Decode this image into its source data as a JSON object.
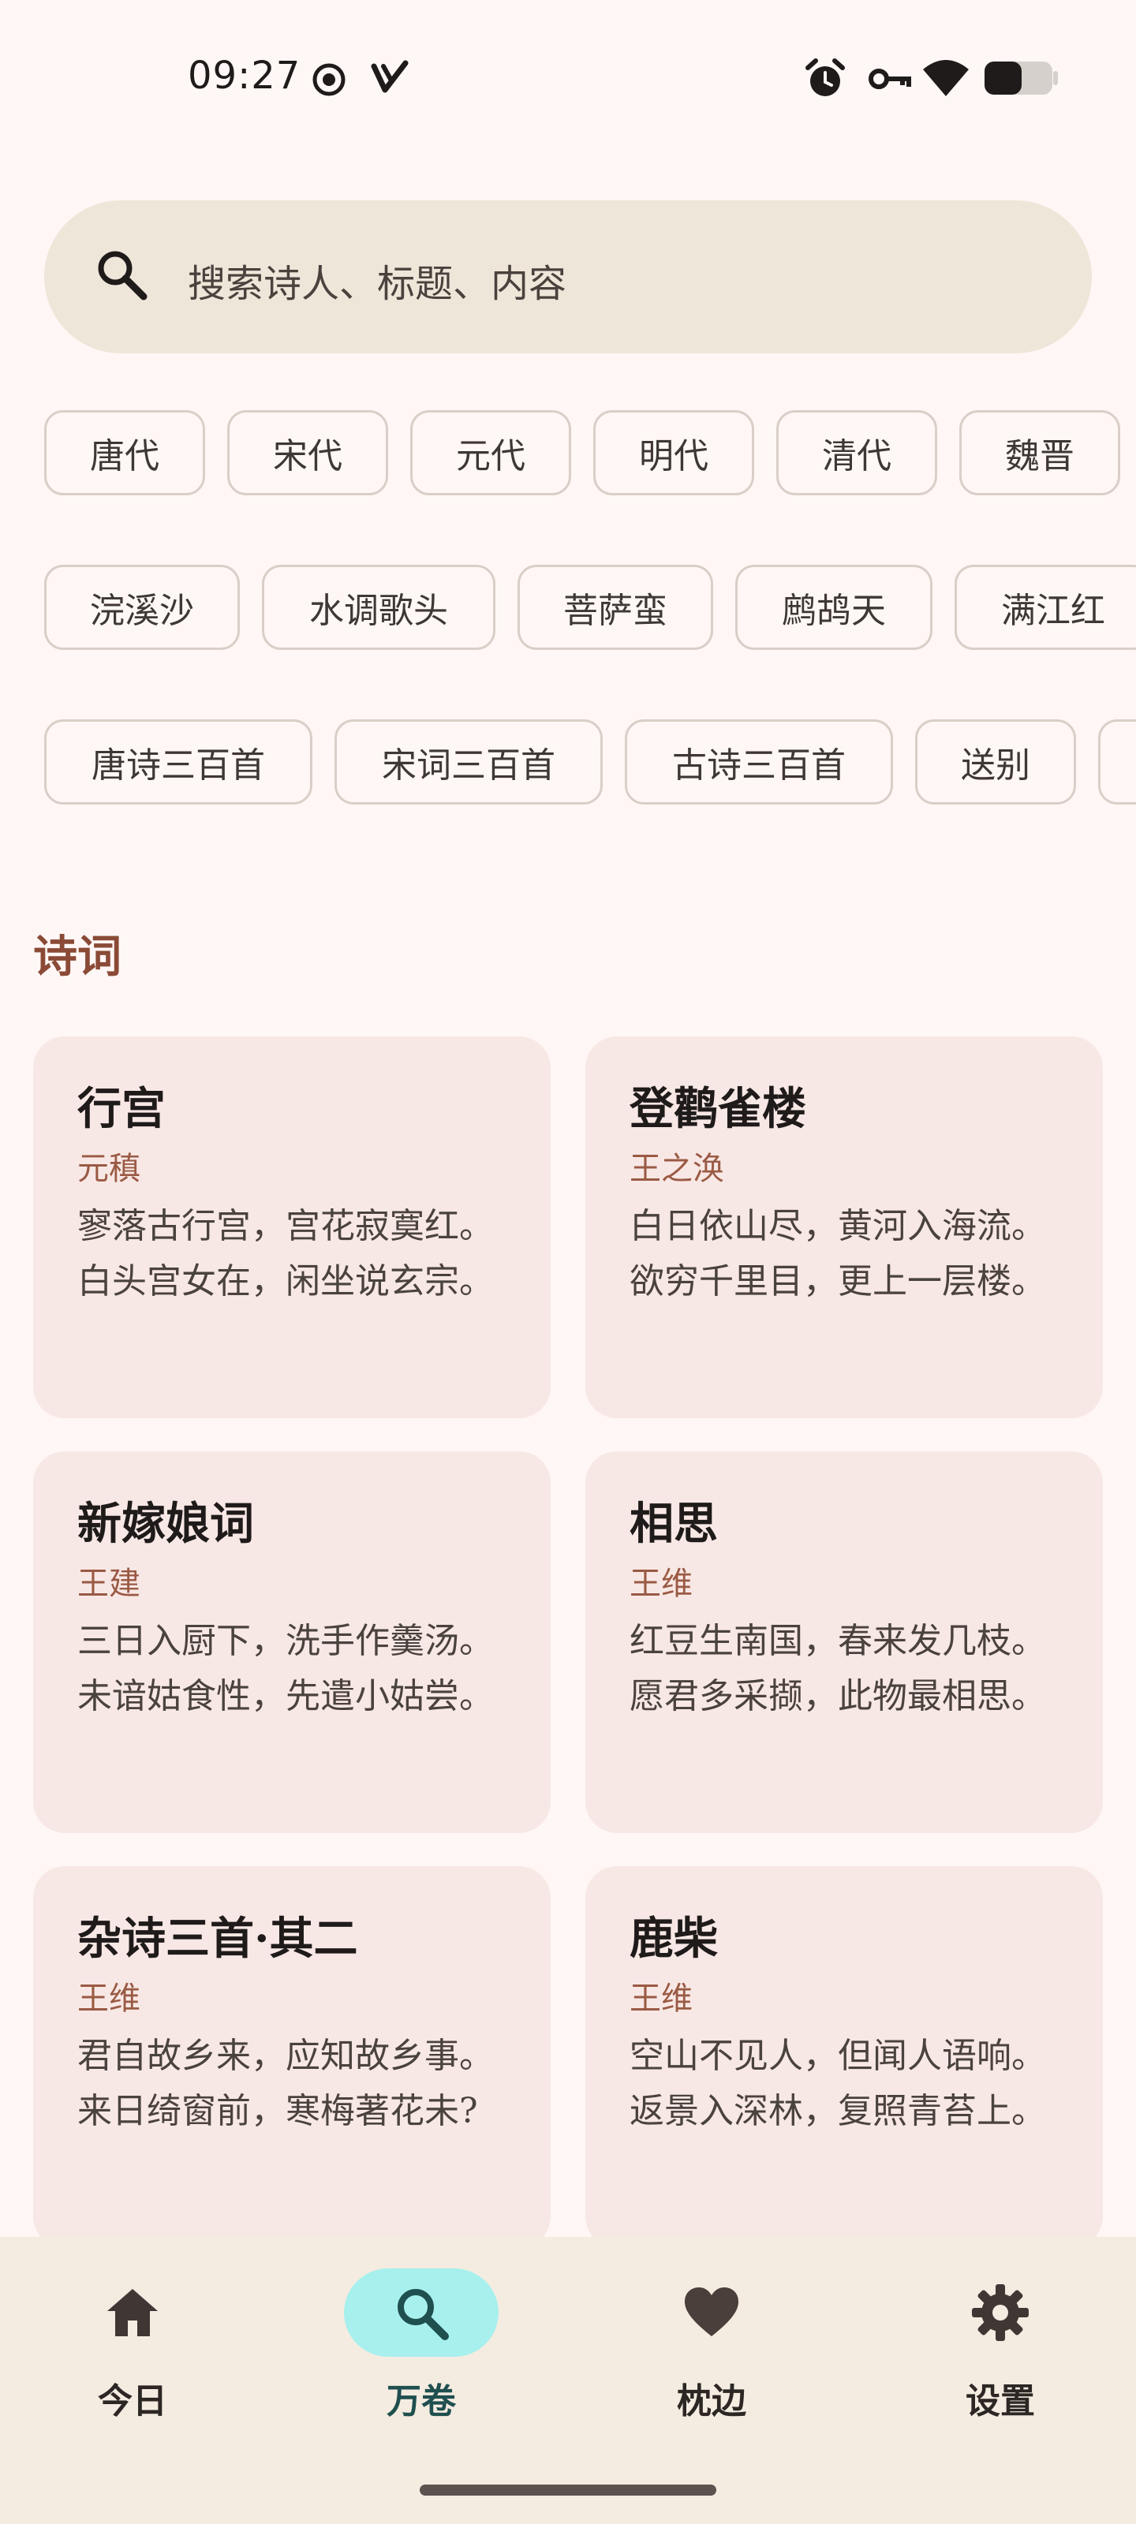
{
  "status_bar": {
    "time": "09:27",
    "icons": [
      "record-icon",
      "v-logo-icon",
      "alarm-icon",
      "key-icon",
      "wifi-icon",
      "battery-icon"
    ],
    "battery_level_fraction": 0.55
  },
  "search": {
    "placeholder": "搜索诗人、标题、内容"
  },
  "chip_rows": [
    {
      "name": "dynasties",
      "chips": [
        "唐代",
        "宋代",
        "元代",
        "明代",
        "清代",
        "魏晋"
      ]
    },
    {
      "name": "cipai",
      "chips": [
        "浣溪沙",
        "水调歌头",
        "菩萨蛮",
        "鹧鸪天",
        "满江红"
      ]
    },
    {
      "name": "collections",
      "chips": [
        "唐诗三百首",
        "宋词三百首",
        "古诗三百首",
        "送别",
        ""
      ]
    }
  ],
  "section": {
    "title": "诗词"
  },
  "poems": [
    {
      "title": "行宫",
      "author": "元稹",
      "excerpt": "寥落古行宫，宫花寂寞红。 白头宫女在，闲坐说玄宗。"
    },
    {
      "title": "登鹳雀楼",
      "author": "王之涣",
      "excerpt": "白日依山尽，黄河入海流。 欲穷千里目，更上一层楼。"
    },
    {
      "title": "新嫁娘词",
      "author": "王建",
      "excerpt": "三日入厨下，洗手作羹汤。 未谙姑食性，先遣小姑尝。"
    },
    {
      "title": "相思",
      "author": "王维",
      "excerpt": "红豆生南国，春来发几枝。 愿君多采撷，此物最相思。"
    },
    {
      "title": "杂诗三首·其二",
      "author": "王维",
      "excerpt": "君自故乡来，应知故乡事。 来日绮窗前，寒梅著花未?"
    },
    {
      "title": "鹿柴",
      "author": "王维",
      "excerpt": "空山不见人，但闻人语响。 返景入深林，复照青苔上。"
    }
  ],
  "bottom_nav": {
    "items": [
      {
        "label": "今日",
        "icon": "home-icon",
        "active": false
      },
      {
        "label": "万卷",
        "icon": "search-icon",
        "active": true
      },
      {
        "label": "枕边",
        "icon": "heart-icon",
        "active": false
      },
      {
        "label": "设置",
        "icon": "gear-icon",
        "active": false
      }
    ]
  },
  "colors": {
    "background": "#FFF7F5",
    "search_fill": "#EFE6DA",
    "card_fill": "#F8E8E5",
    "accent_brown": "#8A4A36",
    "author_color": "#9A5A44",
    "nav_background": "#F4ECE1",
    "nav_active_pill": "#A7F0EE"
  }
}
